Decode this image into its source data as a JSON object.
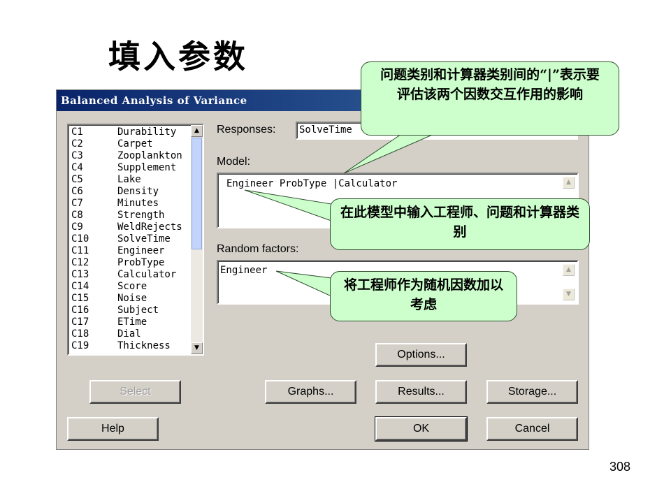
{
  "slide": {
    "title": "填入参数",
    "page_number": "308"
  },
  "dialog": {
    "title": "Balanced Analysis of Variance",
    "columns": [
      {
        "id": "C1",
        "name": "Durability"
      },
      {
        "id": "C2",
        "name": "Carpet"
      },
      {
        "id": "C3",
        "name": "Zooplankton"
      },
      {
        "id": "C4",
        "name": "Supplement"
      },
      {
        "id": "C5",
        "name": "Lake"
      },
      {
        "id": "C6",
        "name": "Density"
      },
      {
        "id": "C7",
        "name": "Minutes"
      },
      {
        "id": "C8",
        "name": "Strength"
      },
      {
        "id": "C9",
        "name": "WeldRejects"
      },
      {
        "id": "C10",
        "name": "SolveTime"
      },
      {
        "id": "C11",
        "name": "Engineer"
      },
      {
        "id": "C12",
        "name": "ProbType"
      },
      {
        "id": "C13",
        "name": "Calculator"
      },
      {
        "id": "C14",
        "name": "Score"
      },
      {
        "id": "C15",
        "name": "Noise"
      },
      {
        "id": "C16",
        "name": "Subject"
      },
      {
        "id": "C17",
        "name": "ETime"
      },
      {
        "id": "C18",
        "name": "Dial"
      },
      {
        "id": "C19",
        "name": "Thickness"
      }
    ],
    "responses_label": "Responses:",
    "responses_value": "SolveTime",
    "model_label": "Model:",
    "model_value": "Engineer ProbType |Calculator",
    "random_factors_label": "Random factors:",
    "random_factors_value": "Engineer",
    "buttons": {
      "options": "Options...",
      "select": "Select",
      "graphs": "Graphs...",
      "results": "Results...",
      "storage": "Storage...",
      "help": "Help",
      "ok": "OK",
      "cancel": "Cancel"
    }
  },
  "callouts": {
    "interaction": "问题类别和计算器类别间的“|”表示要评估该两个因数交互作用的影响",
    "model": "在此模型中输入工程师、问题和计算器类别",
    "random": "将工程师作为随机因数加以考虑"
  },
  "colors": {
    "callout_fill": "#ccffcc",
    "titlebar": "#0a246a",
    "dialog_face": "#d4d0c8"
  }
}
